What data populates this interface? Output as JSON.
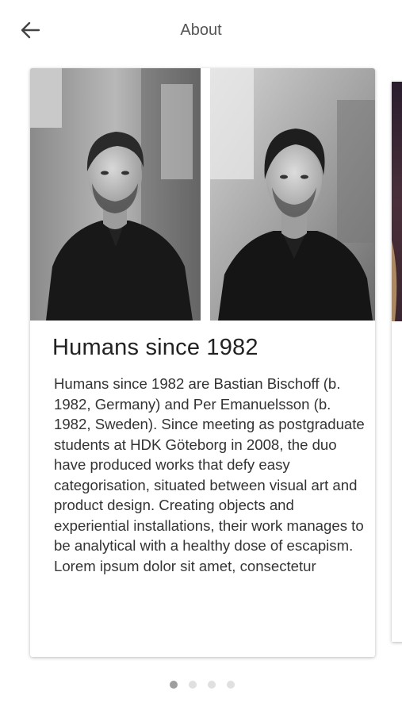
{
  "header": {
    "title": "About",
    "back_icon": "arrow-left-icon"
  },
  "card": {
    "title": "Humans since 1982",
    "body": "Humans since 1982 are Bastian Bischoff (b. 1982, Germany) and Per Emanuelsson (b. 1982, Sweden). Since meeting as postgraduate students at HDK Göteborg in 2008, the duo have produced works that defy easy categorisation, situated between visual art and product design. Creating objects and experiential installations, their work manages to be analytical with a healthy dose of escapism. Lorem ipsum dolor sit amet, consectetur",
    "photos": [
      "portrait-photo",
      "portrait-photo"
    ]
  },
  "pagination": {
    "count": 4,
    "active_index": 0,
    "active_color": "#9e9e9e",
    "inactive_color": "#e0e0e0"
  }
}
